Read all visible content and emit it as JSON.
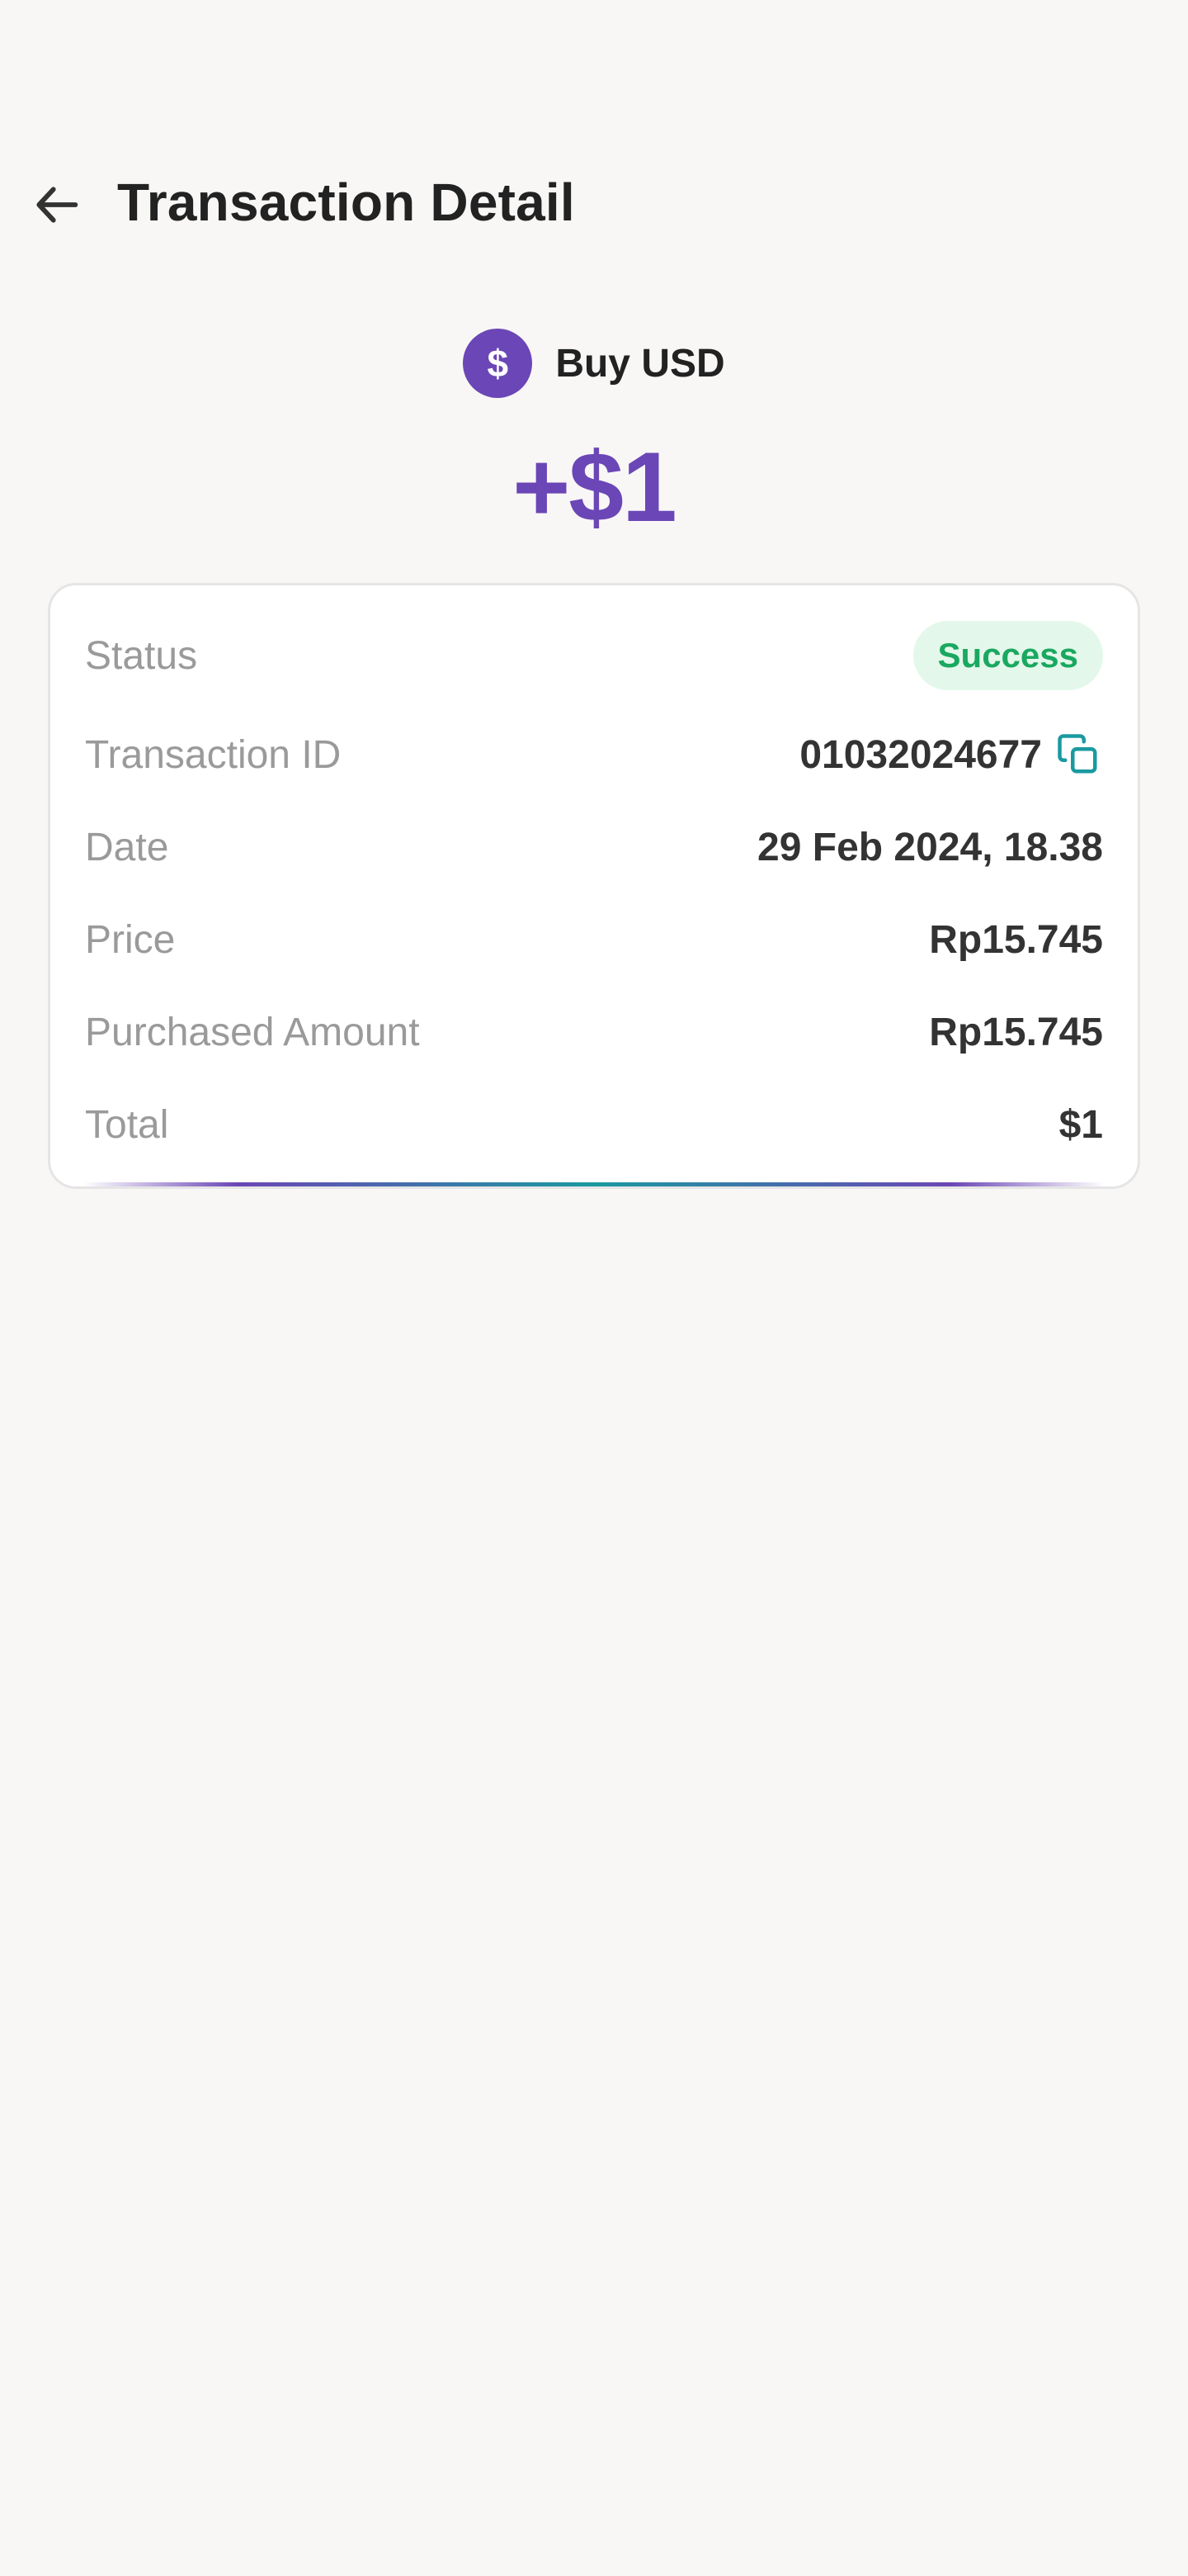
{
  "header": {
    "title": "Transaction Detail",
    "back_icon": "arrow-left-icon"
  },
  "transaction": {
    "type_label": "Buy USD",
    "currency_symbol": "$",
    "amount": "+$1"
  },
  "details": {
    "status": {
      "label": "Status",
      "value": "Success"
    },
    "transaction_id": {
      "label": "Transaction ID",
      "value": "01032024677",
      "action_icon": "copy-icon"
    },
    "date": {
      "label": "Date",
      "value": "29 Feb 2024, 18.38"
    },
    "price": {
      "label": "Price",
      "value": "Rp15.745"
    },
    "purchased_amount": {
      "label": "Purchased Amount",
      "value": "Rp15.745"
    },
    "total": {
      "label": "Total",
      "value": "$1"
    }
  },
  "colors": {
    "background": "#f8f7f6",
    "accent_purple": "#6b46b6",
    "accent_teal": "#1a9aa0",
    "success_text": "#1aa860",
    "success_bg": "#e3f8ea",
    "title_text": "#222222",
    "label_text": "#9a9a9a"
  }
}
